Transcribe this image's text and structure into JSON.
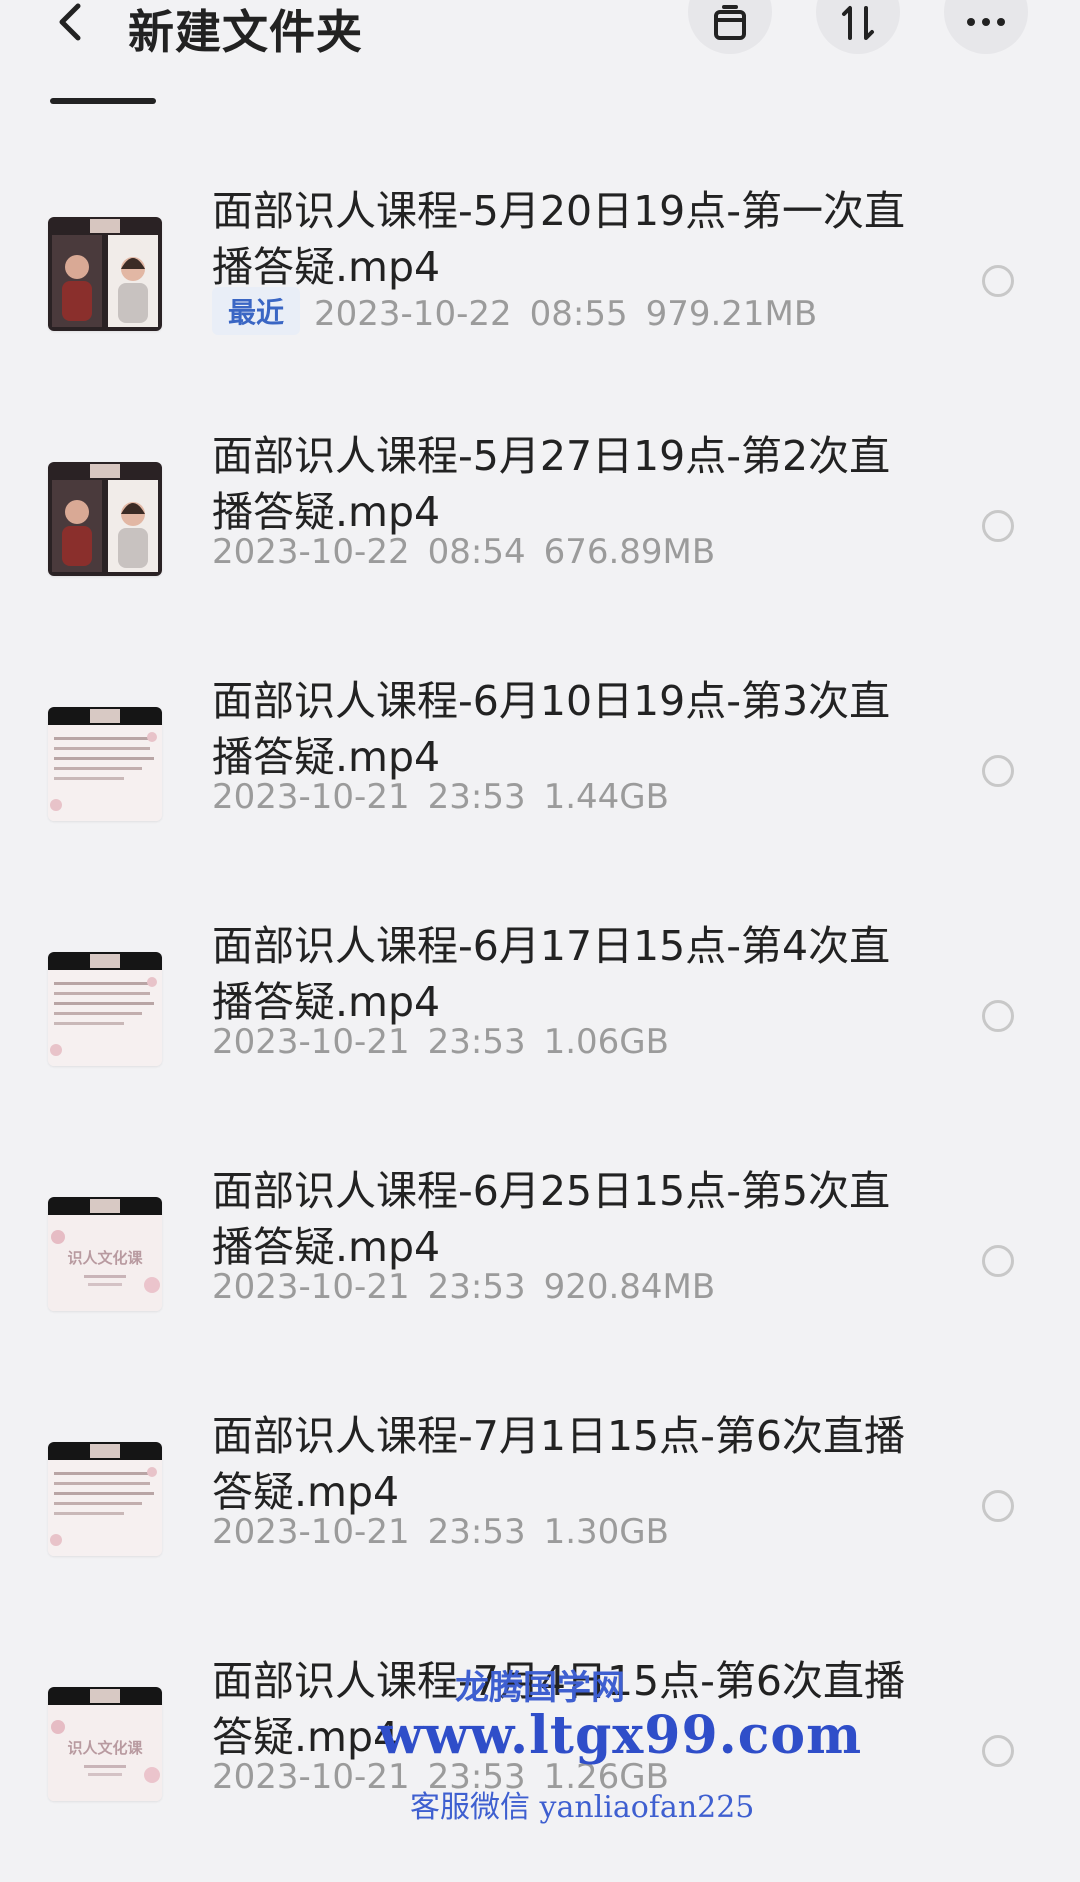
{
  "header": {
    "title": "新建文件夹",
    "icons": [
      "back-arrow-icon",
      "archive-icon",
      "sort-icon",
      "more-icon"
    ]
  },
  "files": [
    {
      "name": "面部识人课程-5月20日19点-第一次直播答疑.mp4",
      "badge": "最近",
      "date": "2023-10-22",
      "time": "08:55",
      "size": "979.21MB",
      "thumb": "video-two-people"
    },
    {
      "name": "面部识人课程-5月27日19点-第2次直播答疑.mp4",
      "badge": "",
      "date": "2023-10-22",
      "time": "08:54",
      "size": "676.89MB",
      "thumb": "video-two-people"
    },
    {
      "name": "面部识人课程-6月10日19点-第3次直播答疑.mp4",
      "badge": "",
      "date": "2023-10-21",
      "time": "23:53",
      "size": "1.44GB",
      "thumb": "video-text-slide"
    },
    {
      "name": "面部识人课程-6月17日15点-第4次直播答疑.mp4",
      "badge": "",
      "date": "2023-10-21",
      "time": "23:53",
      "size": "1.06GB",
      "thumb": "video-text-slide"
    },
    {
      "name": "面部识人课程-6月25日15点-第5次直播答疑.mp4",
      "badge": "",
      "date": "2023-10-21",
      "time": "23:53",
      "size": "920.84MB",
      "thumb": "video-culture-slide",
      "thumb_text": "识人文化课"
    },
    {
      "name": "面部识人课程-7月1日15点-第6次直播答疑.mp4",
      "badge": "",
      "date": "2023-10-21",
      "time": "23:53",
      "size": "1.30GB",
      "thumb": "video-text-slide"
    },
    {
      "name": "面部识人课程-7月4日15点-第6次直播答疑.mp4",
      "badge": "",
      "date": "2023-10-21",
      "time": "23:53",
      "size": "1.26GB",
      "thumb": "video-culture-slide",
      "thumb_text": "识人文化课"
    }
  ],
  "watermark": {
    "line1": "龙腾国学网",
    "line2": "www.ltgx99.com",
    "line3": "客服微信 yanliaofan225"
  },
  "colors": {
    "background": "#f2f2f4",
    "badge_text": "#3a66c4",
    "meta_text": "#9b9b9b",
    "watermark": "#2f4ec9"
  }
}
